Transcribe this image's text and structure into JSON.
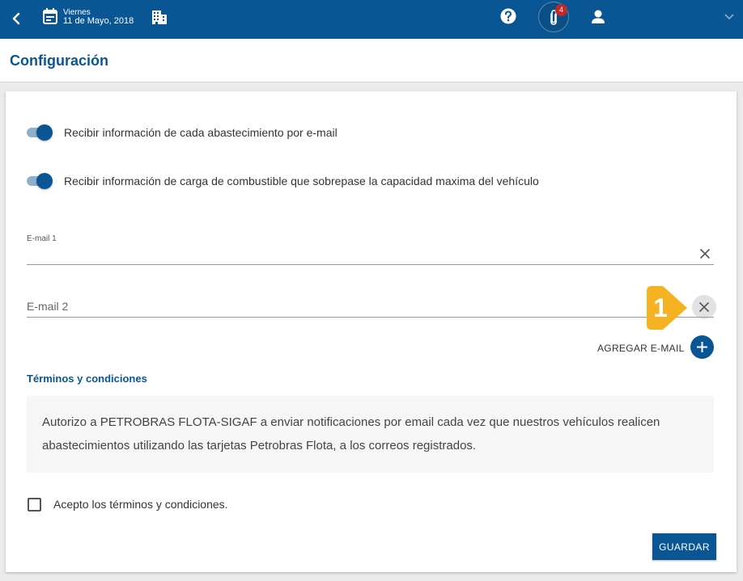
{
  "topbar": {
    "date_day": "Viernes",
    "date_full": "11 de Mayo, 2018",
    "notification_count": "4",
    "icons": [
      "back-arrow-icon",
      "calendar-icon",
      "building-icon",
      "help-icon",
      "paperclip-icon",
      "user-icon",
      "chevron-down-icon"
    ]
  },
  "header": {
    "title": "Configuración"
  },
  "settings": {
    "toggle1_label": "Recibir información de cada abastecimiento por e-mail",
    "toggle1_on": true,
    "toggle2_label": "Recibir información de carga de combustible que sobrepase la capacidad maxima del vehículo",
    "toggle2_on": true
  },
  "email1": {
    "label": "E-mail 1",
    "value": ""
  },
  "email2": {
    "placeholder": "E-mail 2",
    "value": ""
  },
  "step_marker": "1",
  "add_email_label": "AGREGAR E-MAIL",
  "terms": {
    "title": "Términos y condiciones",
    "text": "Autorizo a PETROBRAS FLOTA-SIGAF a enviar notificaciones por email cada vez que nuestros vehículos realicen abastecimientos utilizando las tarjetas Petrobras Flota, a los correos registrados.",
    "accept_label": "Acepto los términos y condiciones.",
    "accepted": false
  },
  "save_label": "GUARDAR",
  "colors": {
    "primary": "#0a5694",
    "accent_marker": "#f5b323",
    "badge": "#c62828"
  }
}
